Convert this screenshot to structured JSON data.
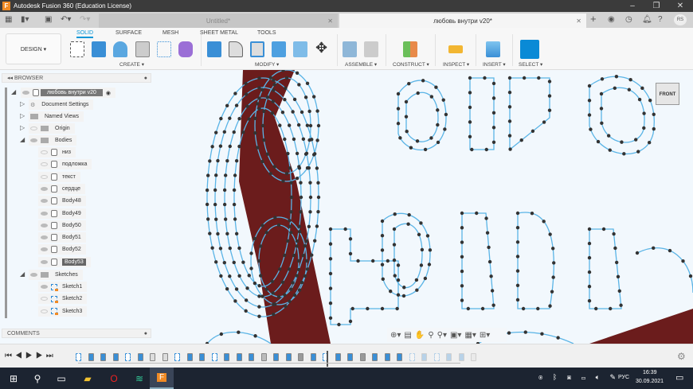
{
  "app": {
    "title": "Autodesk Fusion 360 (Education License)",
    "logo": "F"
  },
  "tabs": [
    {
      "label": "Untitled*",
      "active": false
    },
    {
      "label": "любовь внутри v20*",
      "active": true
    }
  ],
  "user_initials": "RS",
  "toolbar": {
    "workspace": "DESIGN ▾",
    "mode_tabs": [
      "SOLID",
      "SURFACE",
      "MESH",
      "SHEET METAL",
      "TOOLS"
    ],
    "groups": [
      "CREATE ▾",
      "MODIFY ▾",
      "ASSEMBLE ▾",
      "CONSTRUCT ▾",
      "INSPECT ▾",
      "INSERT ▾",
      "SELECT ▾"
    ]
  },
  "browser": {
    "title": "BROWSER",
    "root": "любовь внутри v20",
    "items": [
      {
        "label": "Document Settings"
      },
      {
        "label": "Named Views"
      },
      {
        "label": "Origin"
      },
      {
        "label": "Bodies"
      }
    ],
    "bodies": [
      {
        "label": "низ",
        "visible": false
      },
      {
        "label": "подложка",
        "visible": false
      },
      {
        "label": "текст",
        "visible": false
      },
      {
        "label": "сердце",
        "visible": true
      },
      {
        "label": "Body48",
        "visible": true
      },
      {
        "label": "Body49",
        "visible": true
      },
      {
        "label": "Body50",
        "visible": true
      },
      {
        "label": "Body51",
        "visible": true
      },
      {
        "label": "Body52",
        "visible": true
      },
      {
        "label": "Body53",
        "visible": true,
        "selected": true
      }
    ],
    "sketches_label": "Sketches",
    "sketches": [
      {
        "label": "Sketch1",
        "visible": true
      },
      {
        "label": "Sketch2",
        "visible": false
      },
      {
        "label": "Sketch3",
        "visible": false
      }
    ]
  },
  "comments": {
    "title": "COMMENTS"
  },
  "viewcube": {
    "label": "FRONT"
  },
  "timeline": {
    "features": [
      "sketch",
      "body",
      "body",
      "body",
      "sketch",
      "body",
      "fillet",
      "fillet",
      "sketch",
      "body",
      "body",
      "sketch",
      "body",
      "body",
      "body",
      "shell",
      "body",
      "body",
      "box",
      "body",
      "sketch",
      "body",
      "body",
      "box",
      "body",
      "body",
      "body",
      "sketch",
      "body",
      "sketch",
      "body",
      "body",
      "fillet"
    ],
    "marker_after": 21
  },
  "taskbar": {
    "lang": "РУС",
    "time": "16:39",
    "date": "30.09.2021"
  }
}
